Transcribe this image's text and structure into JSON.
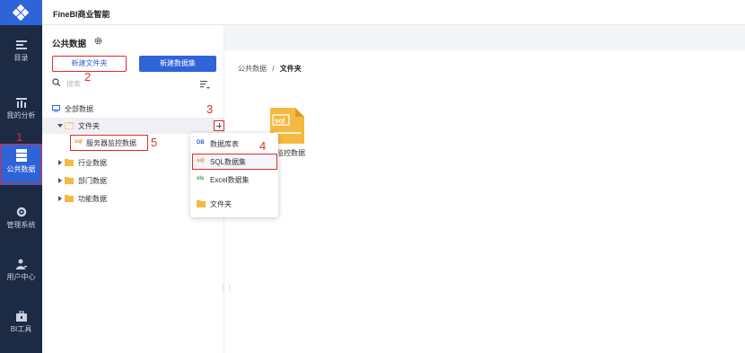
{
  "app": {
    "title": "FineBI商业智能"
  },
  "nav": {
    "items": [
      {
        "label": "目录",
        "icon": "catalog-icon"
      },
      {
        "label": "我的分析",
        "icon": "analysis-icon"
      },
      {
        "label": "公共数据",
        "icon": "public-data-icon",
        "active": true
      },
      {
        "label": "管理系统",
        "icon": "management-icon"
      },
      {
        "label": "用户中心",
        "icon": "user-center-icon"
      },
      {
        "label": "BI工具",
        "icon": "bi-tools-icon"
      }
    ]
  },
  "panel": {
    "title": "公共数据",
    "new_folder_label": "新建文件夹",
    "new_dataset_label": "新建数据集",
    "search_placeholder": "搜索"
  },
  "tree": {
    "root": "全部数据",
    "folders": [
      {
        "label": "文件夹",
        "expanded": true
      },
      {
        "label": "服务器监控数据",
        "type": "sql"
      },
      {
        "label": "行业数据"
      },
      {
        "label": "部门数据"
      },
      {
        "label": "功能数据"
      }
    ]
  },
  "menu": {
    "items": [
      {
        "label": "数据库表",
        "icon": "DB"
      },
      {
        "label": "SQL数据集",
        "icon": "sql"
      },
      {
        "label": "Excel数据集",
        "icon": "xls"
      },
      {
        "label": "文件夹",
        "icon": "folder-icon"
      }
    ]
  },
  "breadcrumb": {
    "root": "公共数据",
    "sep": "/",
    "current": "文件夹"
  },
  "main": {
    "file_name": "器监控数据",
    "file_icon_text": "sql"
  },
  "annotations": [
    "1",
    "2",
    "3",
    "4",
    "5"
  ],
  "colors": {
    "accent": "#2f64d8",
    "nav_bg": "#1d2a43",
    "annotation": "#e02b2b",
    "folder": "#f5b942"
  }
}
